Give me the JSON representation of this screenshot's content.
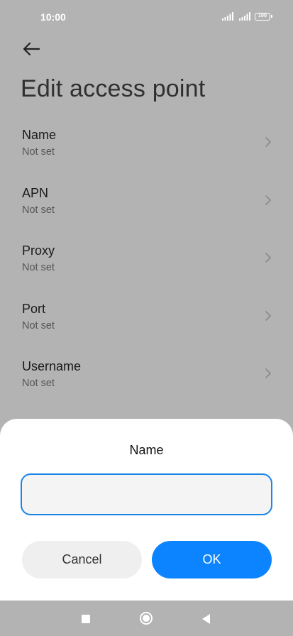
{
  "status_bar": {
    "time": "10:00",
    "battery": "100",
    "icons": [
      "signal-icon",
      "signal-icon",
      "battery-icon"
    ]
  },
  "header": {
    "back_icon": "arrow-left-icon",
    "title": "Edit access point"
  },
  "fields": [
    {
      "label": "Name",
      "value": "Not set"
    },
    {
      "label": "APN",
      "value": "Not set"
    },
    {
      "label": "Proxy",
      "value": "Not set"
    },
    {
      "label": "Port",
      "value": "Not set"
    },
    {
      "label": "Username",
      "value": "Not set"
    }
  ],
  "dialog": {
    "title": "Name",
    "input_value": "",
    "cancel_label": "Cancel",
    "ok_label": "OK"
  },
  "nav_bar": {
    "icons": [
      "recents-square-icon",
      "home-circle-icon",
      "back-triangle-icon"
    ]
  },
  "colors": {
    "accent": "#0c84ff",
    "scrim_background": "#b3b3b3",
    "dialog_background": "#ffffff"
  }
}
